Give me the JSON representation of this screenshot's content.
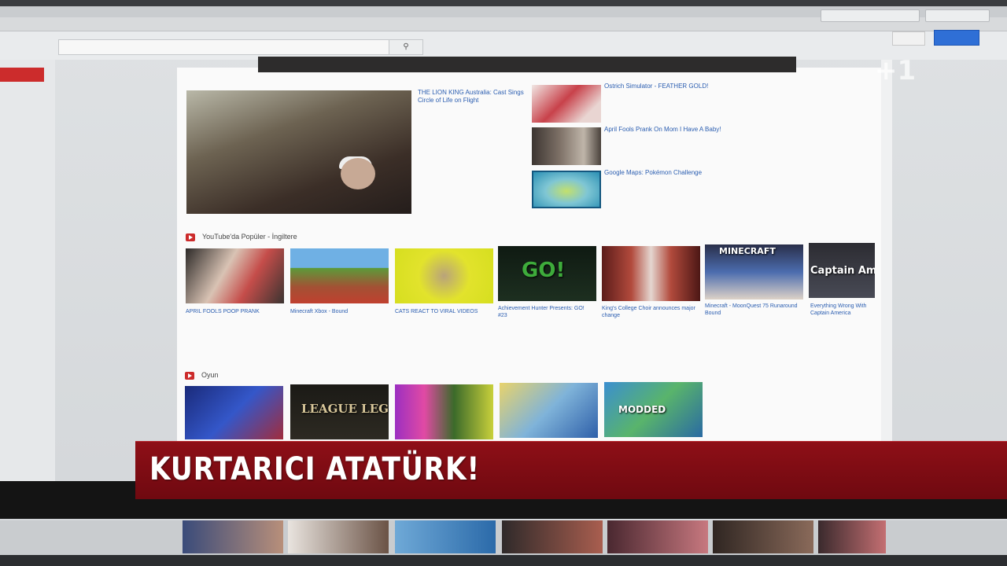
{
  "browser": {
    "info_text": "",
    "buttons": [
      "",
      ""
    ]
  },
  "youtube": {
    "search_placeholder": "",
    "search_icon": "search-icon",
    "signin_label": "",
    "upload_label": ""
  },
  "guide": {
    "items": [
      "",
      "",
      "",
      "",
      "",
      "",
      "",
      ""
    ]
  },
  "featured": {
    "title": "THE LION KING Australia: Cast Sings Circle of Life on Flight",
    "channel": "",
    "views": "",
    "duration": ""
  },
  "side_videos": [
    {
      "title": "Ostrich Simulator - FEATHER GOLD!",
      "meta": "",
      "duration": ""
    },
    {
      "title": "April Fools Prank On Mom I Have A Baby!",
      "meta": "",
      "duration": ""
    },
    {
      "title": "Google Maps: Pokémon Challenge",
      "meta": "",
      "duration": ""
    }
  ],
  "sections": [
    {
      "title": "YouTube'da Popüler - İngiltere",
      "videos": [
        {
          "title": "APRIL FOOLS POOP PRANK",
          "meta": "",
          "duration": "",
          "overlay": ""
        },
        {
          "title": "Minecraft Xbox - Bound",
          "meta": "",
          "duration": "",
          "overlay": ""
        },
        {
          "title": "CATS REACT TO VIRAL VIDEOS",
          "meta": "",
          "duration": "",
          "overlay": ""
        },
        {
          "title": "Achievement Hunter Presents: GO! #23",
          "meta": "",
          "duration": "",
          "overlay": "GO!"
        },
        {
          "title": "King's College Choir announces major change",
          "meta": "",
          "duration": "",
          "overlay": ""
        },
        {
          "title": "Minecraft - MoonQuest 75 Runaround Bound",
          "meta": "",
          "duration": "",
          "overlay": "MINECRAFT"
        },
        {
          "title": "Everything Wrong With Captain America",
          "meta": "",
          "duration": "",
          "overlay": "Captain Am"
        }
      ]
    },
    {
      "title": "Oyun",
      "videos": [
        {
          "duration": "",
          "overlay": ""
        },
        {
          "duration": "",
          "overlay": "LEAGUE LEGENDS"
        },
        {
          "duration": "",
          "overlay": ""
        },
        {
          "duration": "",
          "overlay": ""
        },
        {
          "duration": "",
          "overlay": "MODDED"
        }
      ]
    }
  ],
  "tv": {
    "headline": "KURTARICI ATATÜRK!",
    "channel_bug": "+1",
    "clock": ""
  }
}
